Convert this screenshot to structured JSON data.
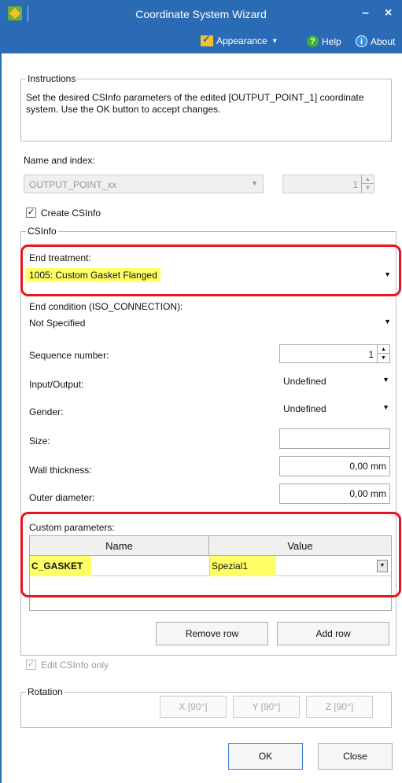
{
  "window": {
    "title": "Coordinate System Wizard",
    "minimize_glyph": "–",
    "close_glyph": "×"
  },
  "menu": {
    "appearance_label": "Appearance",
    "appearance_caret": "▾",
    "help_label": "Help",
    "about_label": "About"
  },
  "instructions": {
    "legend": "Instructions",
    "text": "Set the desired CSInfo parameters of the edited [OUTPUT_POINT_1] coordinate system. Use the OK button to accept changes."
  },
  "name_index": {
    "label": "Name and index:",
    "name_value": "OUTPUT_POINT_xx",
    "index_value": "1"
  },
  "create_csinfo": {
    "label": "Create CSInfo",
    "checked": true,
    "check_glyph": "✓"
  },
  "csinfo": {
    "legend": "CSInfo",
    "end_treatment_label": "End treatment:",
    "end_treatment_value": "1005: Custom Gasket Flanged",
    "end_condition_label": "End condition (ISO_CONNECTION):",
    "end_condition_value": "Not Specified",
    "sequence_label": "Sequence number:",
    "sequence_value": "1",
    "io_label": "Input/Output:",
    "io_value": "Undefined",
    "gender_label": "Gender:",
    "gender_value": "Undefined",
    "size_label": "Size:",
    "size_value": "",
    "wall_label": "Wall thickness:",
    "wall_value": "0,00 mm",
    "outer_label": "Outer diameter:",
    "outer_value": "0,00 mm",
    "custom_label": "Custom parameters:",
    "grid": {
      "headers": [
        "Name",
        "Value"
      ],
      "rows": [
        {
          "name": "C_GASKET",
          "value": "Spezial1"
        }
      ]
    },
    "remove_row_label": "Remove row",
    "add_row_label": "Add row"
  },
  "edit_only": {
    "label": "Edit CSInfo only",
    "checked": true,
    "check_glyph": "✓"
  },
  "rotation": {
    "legend": "Rotation",
    "x_label": "X [90°]",
    "y_label": "Y [90°]",
    "z_label": "Z [90°]"
  },
  "footer": {
    "ok_label": "OK",
    "close_label": "Close"
  },
  "colors": {
    "titlebar": "#2b6bb5",
    "highlight": "#ffff66",
    "annotation_outline": "#e8151f"
  }
}
